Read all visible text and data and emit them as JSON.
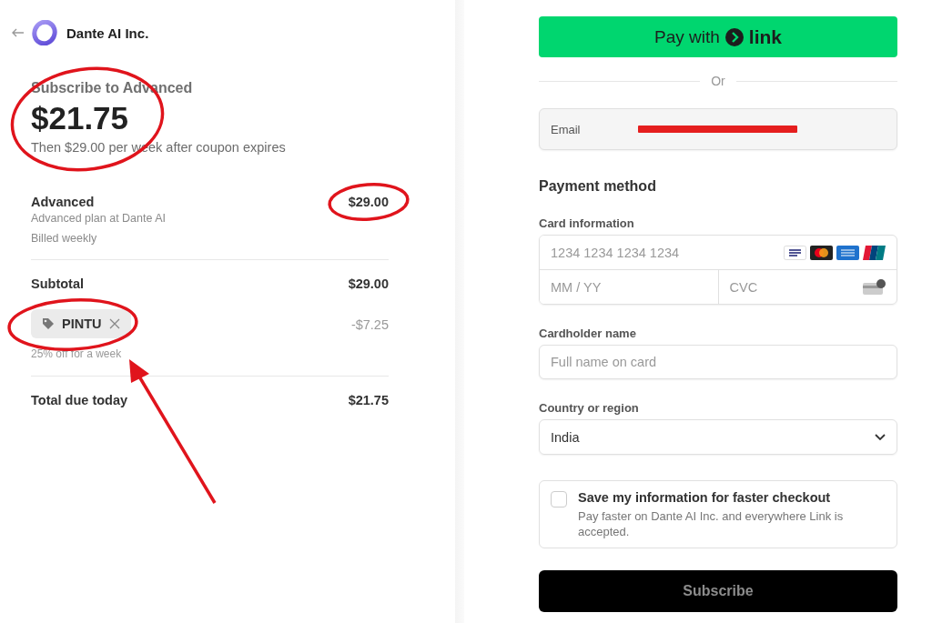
{
  "summary": {
    "company": "Dante AI Inc.",
    "title": "Subscribe to Advanced",
    "amount": "$21.75",
    "note": "Then $29.00 per week after coupon expires",
    "items": [
      {
        "name": "Advanced",
        "description": "Advanced plan at Dante AI",
        "billing": "Billed weekly",
        "price": "$29.00"
      }
    ],
    "subtotal": {
      "label": "Subtotal",
      "value": "$29.00"
    },
    "coupon": {
      "code": "PINTU",
      "description": "25% off for a week",
      "discount": "-$7.25"
    },
    "total": {
      "label": "Total due today",
      "value": "$21.75"
    }
  },
  "form": {
    "pay_button": {
      "label": "Pay with",
      "brand": "link"
    },
    "divider": "Or",
    "email": {
      "label": "Email",
      "redacted": true
    },
    "heading": "Payment method",
    "card": {
      "label": "Card information",
      "number_placeholder": "1234 1234 1234 1234",
      "expiry_placeholder": "MM / YY",
      "cvc_placeholder": "CVC"
    },
    "cardholder": {
      "label": "Cardholder name",
      "placeholder": "Full name on card"
    },
    "country": {
      "label": "Country or region",
      "value": "India"
    },
    "save": {
      "title": "Save my information for faster checkout",
      "description": "Pay faster on Dante AI Inc. and everywhere Link is accepted.",
      "checked": false
    },
    "submit": {
      "label": "Subscribe",
      "disabled": true
    }
  },
  "annotations": [
    {
      "kind": "ellipse"
    },
    {
      "kind": "ellipse"
    },
    {
      "kind": "ellipse"
    },
    {
      "kind": "arrow"
    }
  ]
}
